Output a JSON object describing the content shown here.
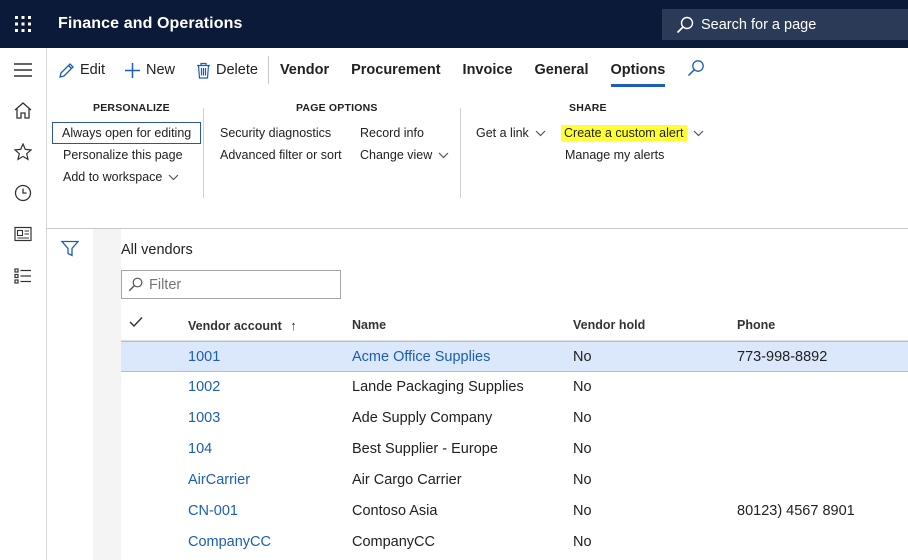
{
  "app": {
    "title": "Finance and Operations",
    "search_label": "Search for a page"
  },
  "action_pane": {
    "edit": "Edit",
    "new": "New",
    "delete": "Delete",
    "tabs": [
      "Vendor",
      "Procurement",
      "Invoice",
      "General",
      "Options"
    ],
    "active_tab": "Options"
  },
  "ribbon": {
    "personalize": {
      "heading": "PERSONALIZE",
      "items": [
        "Always open for editing",
        "Personalize this page",
        "Add to workspace"
      ]
    },
    "page_options": {
      "heading": "PAGE OPTIONS",
      "items": [
        "Security diagnostics",
        "Advanced filter or sort",
        "Record info",
        "Change view"
      ]
    },
    "share": {
      "heading": "SHARE",
      "items": [
        "Get a link",
        "Create a custom alert",
        "Manage my alerts"
      ]
    }
  },
  "page": {
    "caption": "All vendors",
    "filter_placeholder": "Filter"
  },
  "grid": {
    "columns": [
      "Vendor account",
      "Name",
      "Vendor hold",
      "Phone"
    ],
    "sort_indicator": "↑",
    "rows": [
      {
        "account": "1001",
        "name": "Acme Office Supplies",
        "hold": "No",
        "phone": "773-998-8892"
      },
      {
        "account": "1002",
        "name": "Lande Packaging Supplies",
        "hold": "No",
        "phone": ""
      },
      {
        "account": "1003",
        "name": "Ade Supply Company",
        "hold": "No",
        "phone": ""
      },
      {
        "account": "104",
        "name": "Best Supplier - Europe",
        "hold": "No",
        "phone": ""
      },
      {
        "account": "AirCarrier",
        "name": "Air Cargo Carrier",
        "hold": "No",
        "phone": ""
      },
      {
        "account": "CN-001",
        "name": "Contoso Asia",
        "hold": "No",
        "phone": "80123) 4567 8901"
      },
      {
        "account": "CompanyCC",
        "name": "CompanyCC",
        "hold": "No",
        "phone": ""
      }
    ]
  },
  "colors": {
    "header_bg": "#0b1a38",
    "accent": "#1a5fb4",
    "highlight": "#ffff33",
    "selected_row": "#dbe7fb"
  }
}
